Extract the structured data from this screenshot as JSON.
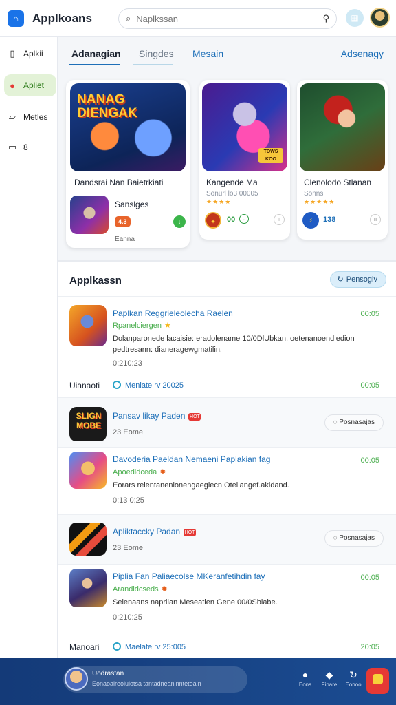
{
  "header": {
    "title": "Applkoans",
    "search_placeholder": "Naplkssan"
  },
  "sidebar": {
    "items": [
      {
        "label": "Aplkii",
        "icon": "phone-icon"
      },
      {
        "label": "Apliet",
        "icon": "app-icon"
      },
      {
        "label": "Metles",
        "icon": "tablet-icon"
      },
      {
        "label": "8",
        "icon": "window-icon"
      }
    ]
  },
  "tabs": [
    {
      "label": "Adanagian"
    },
    {
      "label": "Singdes"
    },
    {
      "label": "Mesain"
    },
    {
      "label": "Adsenagy"
    }
  ],
  "featured": [
    {
      "art_text": "NANAG DIENGAK",
      "title": "Dandsrai Nan Baietrkiati",
      "sub_title": "Sanslges",
      "sub_rating": "4.3",
      "sub_label": "Eanna"
    },
    {
      "title": "Kangende Ma",
      "subtitle": "Sonurl lo3 00005",
      "stars": "★★★★",
      "art_badge": "TOWS KOO",
      "count": "00"
    },
    {
      "title": "Clenolodo Stlanan",
      "subtitle": "Sonns",
      "stars": "★★★★★",
      "count": "138"
    }
  ],
  "apps": {
    "title": "Applkassn",
    "button_label": "Pensogiv",
    "rows": [
      {
        "name": "Paplkan Reggrieleolecha Raelen",
        "tag": "Rpanelciergen",
        "desc": "Dolanparonede lacaisie: eradolename 10/0DlUbkan, oetenanoendiedion pedtresann: dianeragewgmatilin.",
        "meta": "0:210:23",
        "time": "00:05",
        "foot_label": "Uianaoti",
        "foot_link": "Meniate rv 20025",
        "foot_time": "00:05"
      },
      {
        "name": "Pansav likay Paden",
        "hot": "HOT",
        "meta": "23 Eome",
        "art_text": "SLIGN MOBE",
        "button": "Posnasajas"
      },
      {
        "name": "Davoderia Paeldan Nemaeni Paplakian fag",
        "tag": "Apoedidceda",
        "desc": "Eorars relentanenlonengaeglecn Otellangef.akidand.",
        "meta": "0:13 0:25",
        "time": "00:05"
      },
      {
        "name": "Apliktaccky Padan",
        "hot": "HOT",
        "meta": "23 Eome",
        "button": "Posnasajas"
      },
      {
        "name": "Piplia Fan Paliaecolse MKeranfetihdin fay",
        "tag": "Arandidcseds",
        "desc": "Selenaans naprilan Meseatien Gene 00/0Sblabe.",
        "meta": "0:210:25",
        "time": "00:05",
        "foot_label": "Manoari",
        "foot_link": "Maelate rv 25:005",
        "foot_time": "20:05"
      }
    ]
  },
  "bottom": {
    "player_title": "Uodrastan",
    "player_sub": "Eonaoalreolulotsa tantadneaninntetoain",
    "nav": [
      {
        "label": "Eons",
        "icon": "user-icon"
      },
      {
        "label": "Finare",
        "icon": "tag-icon"
      },
      {
        "label": "Eonoo",
        "icon": "refresh-icon"
      }
    ]
  },
  "colors": {
    "accent": "#1d6fb8",
    "active_green": "#4caf50",
    "bottom_bar": "#1b4c92",
    "hot_red": "#e53935"
  }
}
